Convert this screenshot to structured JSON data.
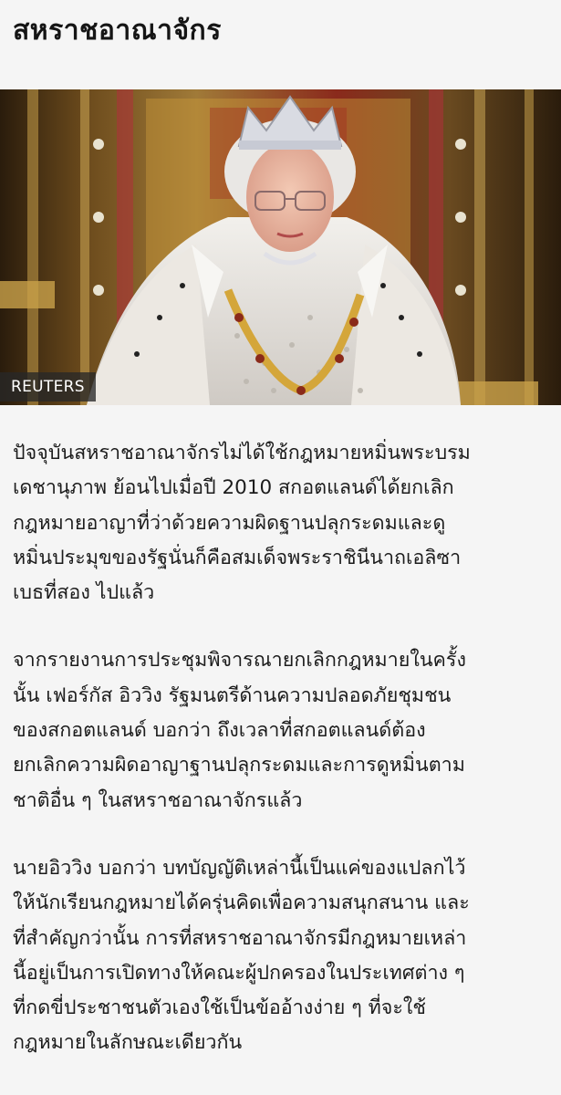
{
  "article": {
    "title": "สหราชอาณาจักร",
    "image_credit": "REUTERS",
    "paragraphs": [
      [
        "ปัจจุบันสหราชอาณาจักรไม่ได้ใช้กฎหมายหมิ่นพระบรม",
        "เดชานุภาพ ย้อนไปเมื่อปี 2010 สกอตแลนด์ได้ยกเลิก",
        "กฎหมายอาญาที่ว่าด้วยความผิดฐานปลุกระดมและดู",
        "หมิ่นประมุขของรัฐนั่นก็คือสมเด็จพระราชินีนาถเอลิซา",
        "เบธที่สอง ไปแล้ว"
      ],
      [
        "จากรายงานการประชุมพิจารณายกเลิกกฎหมายในครั้ง",
        "นั้น เฟอร์กัส อิววิง รัฐมนตรีด้านความปลอดภัยชุมชน",
        "ของสกอตแลนด์ บอกว่า ถึงเวลาที่สกอตแลนด์ต้อง",
        "ยกเลิกความผิดอาญาฐานปลุกระดมและการดูหมิ่นตาม",
        "ชาติอื่น ๆ ในสหราชอาณาจักรแล้ว"
      ],
      [
        "นายอิววิง บอกว่า บทบัญญัติเหล่านี้เป็นแค่ของแปลกไว้",
        "ให้นักเรียนกฎหมายได้ครุ่นคิดเพื่อความสนุกสนาน และ",
        "ที่สำคัญกว่านั้น การที่สหราชอาณาจักรมีกฎหมายเหล่า",
        "นี้อยู่เป็นการเปิดทางให้คณะผู้ปกครองในประเทศต่าง ๆ",
        "ที่กดขี่ประชาชนตัวเองใช้เป็นข้ออ้างง่าย ๆ ที่จะใช้",
        "กฎหมายในลักษณะเดียวกัน"
      ]
    ]
  }
}
